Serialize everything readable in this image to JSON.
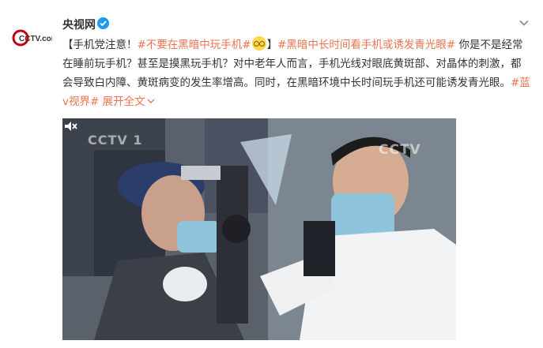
{
  "author": {
    "name": "央视网",
    "avatar_text": "CCTV.com",
    "avatar_subtext": "央视网"
  },
  "post": {
    "bracket_open": "【",
    "lead": "手机党注意！",
    "tag1": "#不要在黑暗中玩手机#",
    "bracket_close": "】",
    "tag2": "#黑暗中长时间看手机或诱发青光眼#",
    "body": " 你是不是经常在睡前玩手机？甚至是摸黑玩手机？对中老年人而言，手机光线对眼底黄斑部、对晶体的刺激，都会导致白内障、黄斑病变的发生率增高。同时，在黑暗环境中长时间玩手机还可能诱发青光眼。",
    "tag3": "#蓝v视界#",
    "expand_label": "展开全文",
    "expand_icon": "chevron-down-icon"
  },
  "video": {
    "watermark_left": "CCTV 1",
    "watermark_right": "CCTV"
  },
  "icons": {
    "verified": "verified-icon",
    "more": "chevron-down-icon",
    "mute": "mute-icon"
  },
  "colors": {
    "link": "#eb7350",
    "verified": "#1d9bf0",
    "text": "#333333"
  }
}
